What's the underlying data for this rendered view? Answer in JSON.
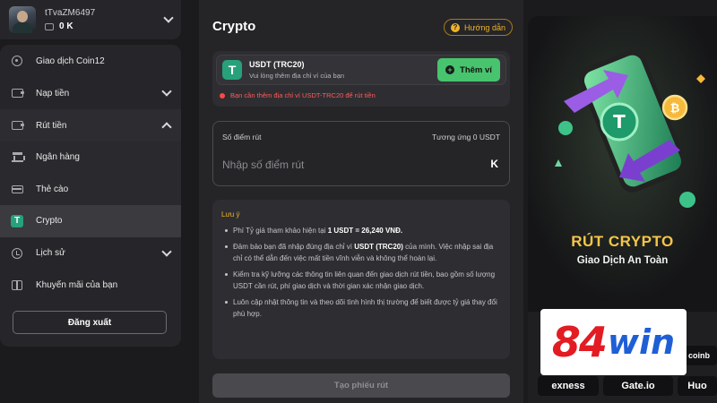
{
  "user": {
    "name": "tTvaZM6497",
    "balance": "0 K"
  },
  "sidebar": {
    "items": [
      {
        "label": "Giao dịch Coin12"
      },
      {
        "label": "Nạp tiền"
      },
      {
        "label": "Rút tiền"
      },
      {
        "label": "Ngân hàng"
      },
      {
        "label": "Thẻ cào"
      },
      {
        "label": "Crypto"
      },
      {
        "label": "Lịch sử"
      },
      {
        "label": "Khuyến mãi của bạn"
      }
    ],
    "logout_label": "Đăng xuất"
  },
  "main": {
    "title": "Crypto",
    "guide_label": "Hướng dẫn",
    "wallet": {
      "name": "USDT (TRC20)",
      "hint": "Vui lòng thêm địa chỉ ví của bạn",
      "add_label": "Thêm ví",
      "warning": "Bạn cần thêm địa chỉ ví USDT-TRC20 để rút tiền"
    },
    "amount": {
      "label": "Số điểm rút",
      "equiv": "Tương ứng 0 USDT",
      "placeholder": "Nhập số điểm rút",
      "unit": "K"
    },
    "notes": {
      "title": "Lưu ý",
      "items": [
        {
          "a": "Phí Tỷ giá tham khảo hiện tại ",
          "b": "1 USDT = 26,240 VNĐ.",
          "c": ""
        },
        {
          "a": "Đảm bảo bạn đã nhập đúng địa chỉ ví ",
          "b": "USDT (TRC20)",
          "c": " của mình. Việc nhập sai địa chỉ có thể dẫn đến việc mất tiền vĩnh viễn và không thể hoàn lại."
        },
        {
          "a": "Kiểm tra kỹ lưỡng các thông tin liên quan đến giao dịch rút tiền, bao gồm số lượng USDT cần rút, phí giao dịch và thời gian xác nhận giao dịch.",
          "b": "",
          "c": ""
        },
        {
          "a": "Luôn cập nhật thông tin và theo dõi tình hình thị trường để biết được tỷ giá thay đổi phù hợp.",
          "b": "",
          "c": ""
        }
      ]
    },
    "submit_label": "Tạo phiếu rút"
  },
  "promo": {
    "title": "RÚT CRYPTO",
    "subtitle": "Giao Dịch An Toàn",
    "brand_number": "84",
    "brand_word": "win",
    "partners": [
      "coinb",
      "exness",
      "Gate.io",
      "Huo"
    ]
  },
  "colors": {
    "accent_green": "#47c46d",
    "accent_gold": "#f0b329",
    "tether_green": "#27a17a",
    "warning_red": "#ff5b5b"
  }
}
